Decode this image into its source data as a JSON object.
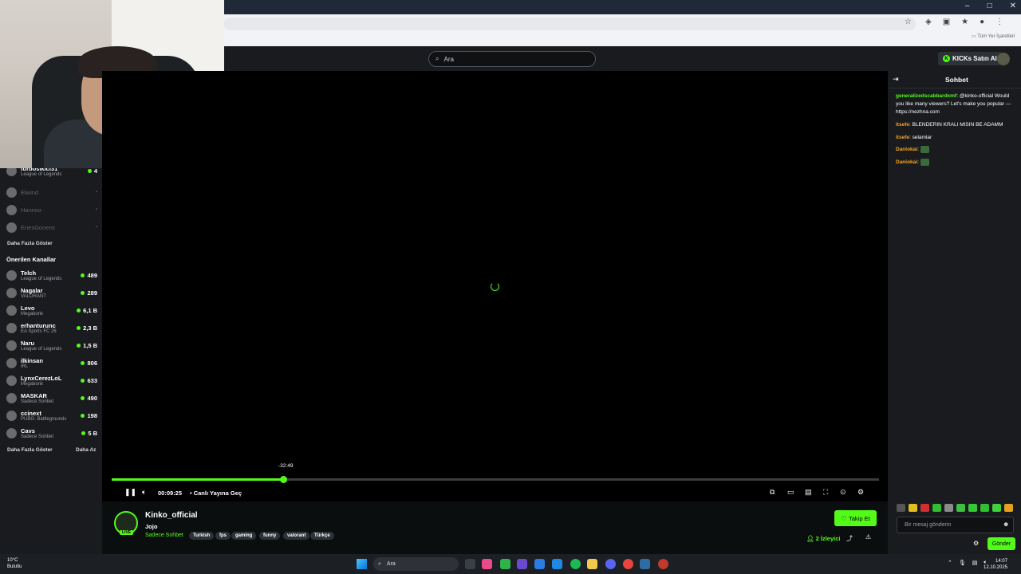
{
  "browser": {
    "window_controls": [
      "–",
      "□",
      "✕"
    ],
    "bookmarks_label": "Tüm Yer İşaretleri"
  },
  "header": {
    "search_placeholder": "Ara",
    "buy_kicks_label": "KICKs Satın Al"
  },
  "sidebar": {
    "following": [
      {
        "name": "turbosikici31",
        "category": "League of Legends",
        "count": "4",
        "online": true
      },
      {
        "name": "Elwind",
        "category": "",
        "count": "",
        "online": false
      },
      {
        "name": "Hannso",
        "category": "",
        "count": "",
        "online": false
      },
      {
        "name": "EnesGonenc",
        "category": "",
        "count": "",
        "online": false
      }
    ],
    "show_more_following": "Daha Fazla Göster",
    "recommended_title": "Önerilen Kanallar",
    "recommended": [
      {
        "name": "Telch",
        "category": "League of Legends",
        "count": "489"
      },
      {
        "name": "Nagalar",
        "category": "VALORANT",
        "count": "289"
      },
      {
        "name": "Levo",
        "category": "Megabonk",
        "count": "6,1 B"
      },
      {
        "name": "erhanturunc",
        "category": "EA Sports FC 26",
        "count": "2,3 B"
      },
      {
        "name": "Naru",
        "category": "League of Legends",
        "count": "1,5 B"
      },
      {
        "name": "ilkinsan",
        "category": "IRL",
        "count": "806"
      },
      {
        "name": "LynxCerezLoL",
        "category": "Megabonk",
        "count": "633"
      },
      {
        "name": "MASKAR",
        "category": "Sadece Sohbet",
        "count": "490"
      },
      {
        "name": "ccinext",
        "category": "PUBG: Battlegrounds",
        "count": "198"
      },
      {
        "name": "Cavs",
        "category": "Sadece Sohbet",
        "count": "5 B"
      }
    ],
    "show_more": "Daha Fazla Göster",
    "show_less": "Daha Az"
  },
  "player": {
    "progress": 0.224,
    "hover_time": "-32:49",
    "elapsed": "00:09:25",
    "go_live": "Canlı Yayına Geç"
  },
  "channel": {
    "name": "Kinko_official",
    "live_badge": "LIVE",
    "stream_title": "Jojo",
    "category": "Sadece Sohbet",
    "tags": [
      "Turkish",
      "fps",
      "gaming",
      "funny",
      "valorant",
      "Türkçe"
    ],
    "follow_label": "Takip Et",
    "viewers_label": "2 İzleyici"
  },
  "chat": {
    "title": "Sohbet",
    "messages": [
      {
        "user": "generalizedscabbardxmf",
        "text": "@kinko-official Would you like many viewers? Let's make you popular — https://nezhna.com",
        "color": "#53fc18"
      },
      {
        "user": "itsefe",
        "text": "BLENDERIN KRALI MISIN BE ADAMM",
        "color": "#f5a623"
      },
      {
        "user": "itsefe",
        "text": "selamlar",
        "color": "#f5a623"
      },
      {
        "user": "Daniokai",
        "text": "",
        "color": "#f5a623",
        "emote": true
      },
      {
        "user": "Daniokai",
        "text": "",
        "color": "#f5a623",
        "emote": true
      }
    ],
    "input_placeholder": "Bir mesaj gönderin",
    "send_label": "Gönder"
  },
  "taskbar": {
    "temperature": "10°C",
    "weather": "Bulutlu",
    "search_placeholder": "Ara",
    "time": "14:07",
    "date": "12.10.2025"
  },
  "colors": {
    "accent": "#53fc18",
    "background": "#0b0e0f",
    "panel": "#191b1f"
  }
}
